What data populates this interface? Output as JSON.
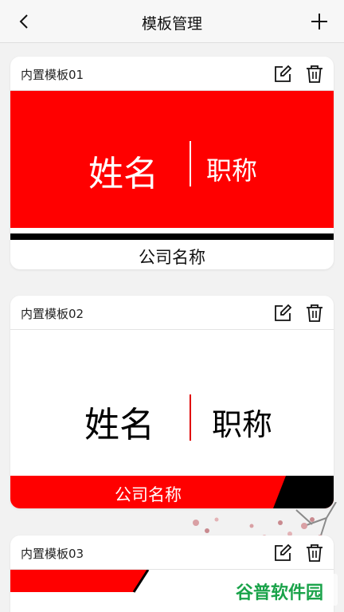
{
  "header": {
    "title": "模板管理"
  },
  "templates": [
    {
      "label": "内置模板01",
      "name": "姓名",
      "job_title": "职称",
      "company": "公司名称",
      "accent": "#ff0000"
    },
    {
      "label": "内置模板02",
      "name": "姓名",
      "job_title": "职称",
      "company": "公司名称",
      "accent": "#ff0000"
    },
    {
      "label": "内置模板03",
      "accent": "#ff0000"
    }
  ],
  "watermark": {
    "text": "谷普软件园",
    "color": "#1aa34a"
  },
  "icons": {
    "back": "chevron-left-icon",
    "add": "plus-icon",
    "edit": "edit-icon",
    "delete": "trash-icon"
  }
}
